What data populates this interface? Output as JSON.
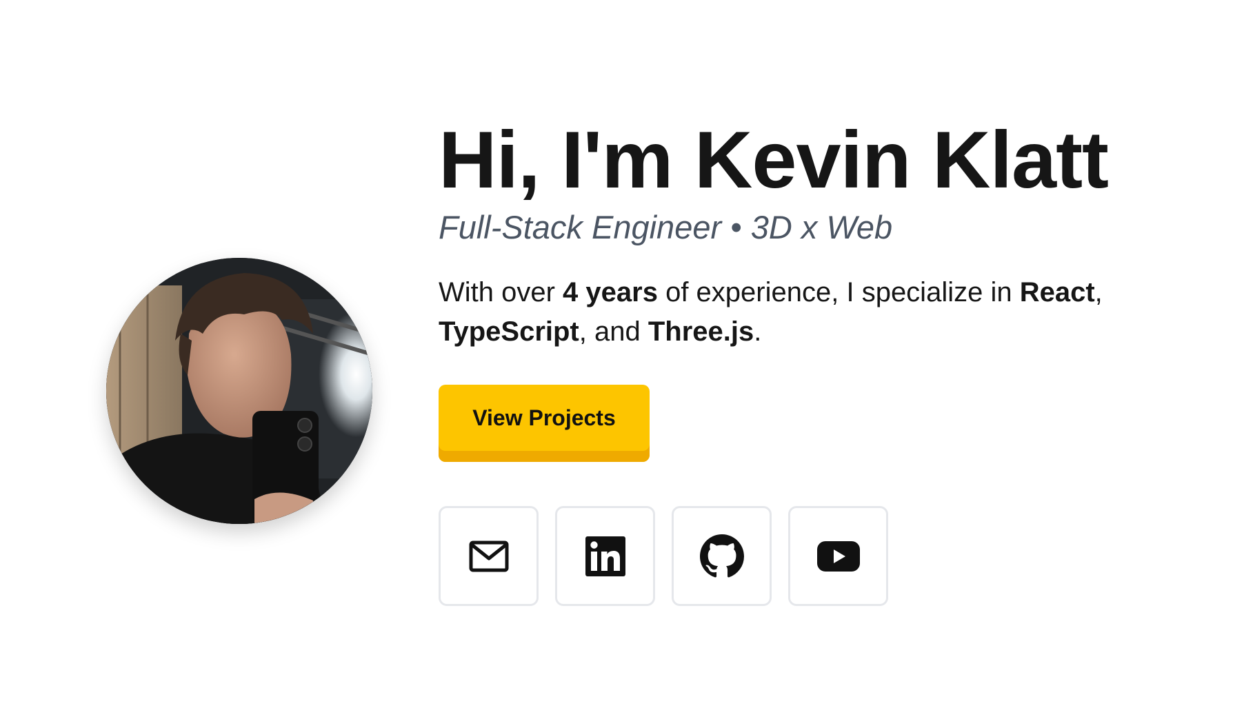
{
  "hero": {
    "title": "Hi, I'm Kevin Klatt",
    "subtitle": "Full-Stack Engineer • 3D x Web",
    "bio": {
      "prefix": "With over ",
      "years": "4 years",
      "middle": " of experience, I specialize in ",
      "tech1": "React",
      "sep1": ", ",
      "tech2": "TypeScript",
      "sep2": ", and ",
      "tech3": "Three.js",
      "suffix": "."
    },
    "cta_label": "View Projects"
  },
  "socials": [
    {
      "icon": "mail-icon"
    },
    {
      "icon": "linkedin-icon"
    },
    {
      "icon": "github-icon"
    },
    {
      "icon": "youtube-icon"
    }
  ],
  "colors": {
    "accent": "#fdc500",
    "accent_shadow": "#efaa00",
    "text": "#161616",
    "subtitle": "#4b5563",
    "card_border": "#e5e7eb"
  }
}
